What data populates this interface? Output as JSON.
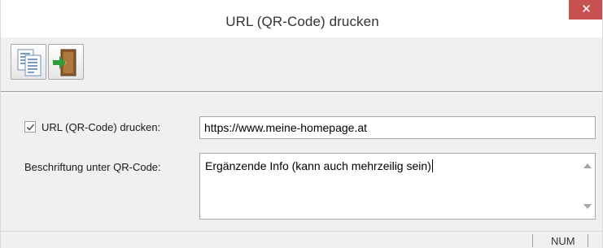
{
  "window": {
    "title": "URL (QR-Code) drucken",
    "close_symbol": "✕"
  },
  "toolbar": {
    "buttons": [
      {
        "icon": "copy-pages-icon"
      },
      {
        "icon": "exit-door-icon"
      }
    ]
  },
  "form": {
    "url_checkbox_checked": true,
    "url_label": "URL (QR-Code) drucken:",
    "url_value": "https://www.meine-homepage.at",
    "caption_label": "Beschriftung unter QR-Code:",
    "caption_value": "Ergänzende Info  (kann auch mehrzeilig sein)"
  },
  "statusbar": {
    "num_indicator": "NUM"
  },
  "colors": {
    "close_button": "#c75050",
    "window_bg": "#f0f0f0"
  }
}
